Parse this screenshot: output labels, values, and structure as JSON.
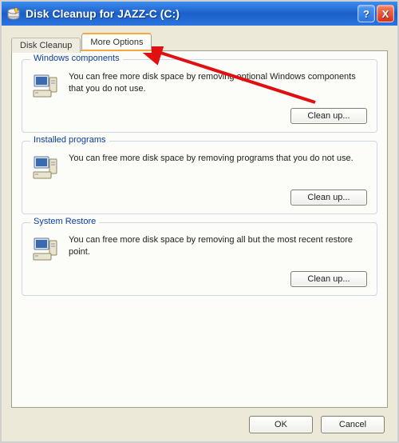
{
  "window": {
    "title": "Disk Cleanup for JAZZ-C (C:)",
    "help_glyph": "?",
    "close_glyph": "X"
  },
  "tabs": {
    "disk_cleanup": "Disk Cleanup",
    "more_options": "More Options",
    "active": "more_options"
  },
  "groups": {
    "windows_components": {
      "title": "Windows components",
      "text": "You can free more disk space by removing optional Windows components that you do not use.",
      "button": "Clean up..."
    },
    "installed_programs": {
      "title": "Installed programs",
      "text": "You can free more disk space by removing programs that you do not use.",
      "button": "Clean up..."
    },
    "system_restore": {
      "title": "System Restore",
      "text": "You can free more disk space by removing all but the most recent restore point.",
      "button": "Clean up..."
    }
  },
  "dialog": {
    "ok": "OK",
    "cancel": "Cancel"
  },
  "colors": {
    "arrow": "#e01010"
  }
}
